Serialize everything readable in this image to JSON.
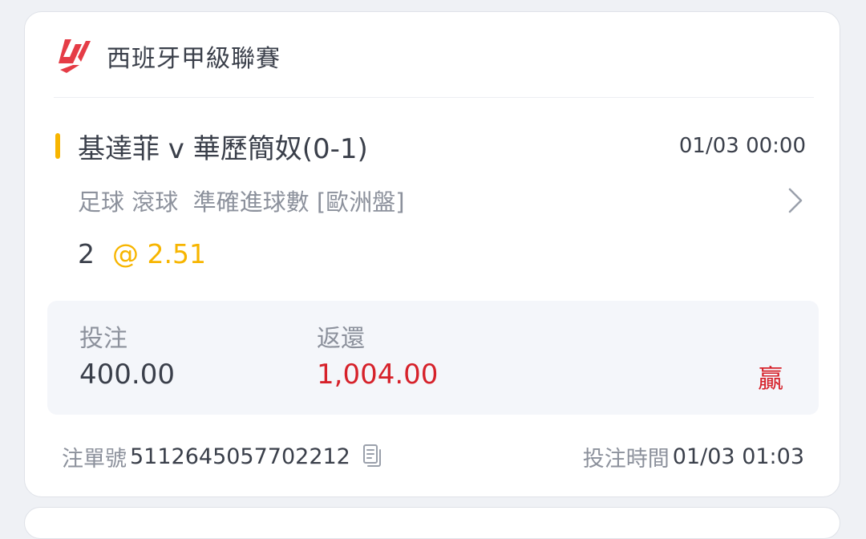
{
  "league": {
    "name": "西班牙甲級聯賽",
    "logo": "laliga-logo"
  },
  "match": {
    "home": "基達菲",
    "separator": "v",
    "away": "華歷簡奴",
    "score": "(0-1)",
    "title": "基達菲 v 華歷簡奴(0-1)",
    "time": "01/03 00:00"
  },
  "market": {
    "text": "足球 滾球  準確進球數 [歐洲盤]",
    "chevron_icon": "chevron-right-icon"
  },
  "selection": {
    "pick": "2",
    "odds": "@ 2.51"
  },
  "stake": {
    "label": "投注",
    "value": "400.00"
  },
  "return": {
    "label": "返還",
    "value": "1,004.00"
  },
  "result": "贏",
  "footer": {
    "bet_no_label": "注單號",
    "bet_no_value": "5112645057702212",
    "copy_icon": "copy-icon",
    "bet_time_label": "投注時間",
    "bet_time_value": "01/03 01:03"
  },
  "colors": {
    "accent": "#f7b500",
    "win": "#d6212a",
    "logo": "#e53c46"
  }
}
